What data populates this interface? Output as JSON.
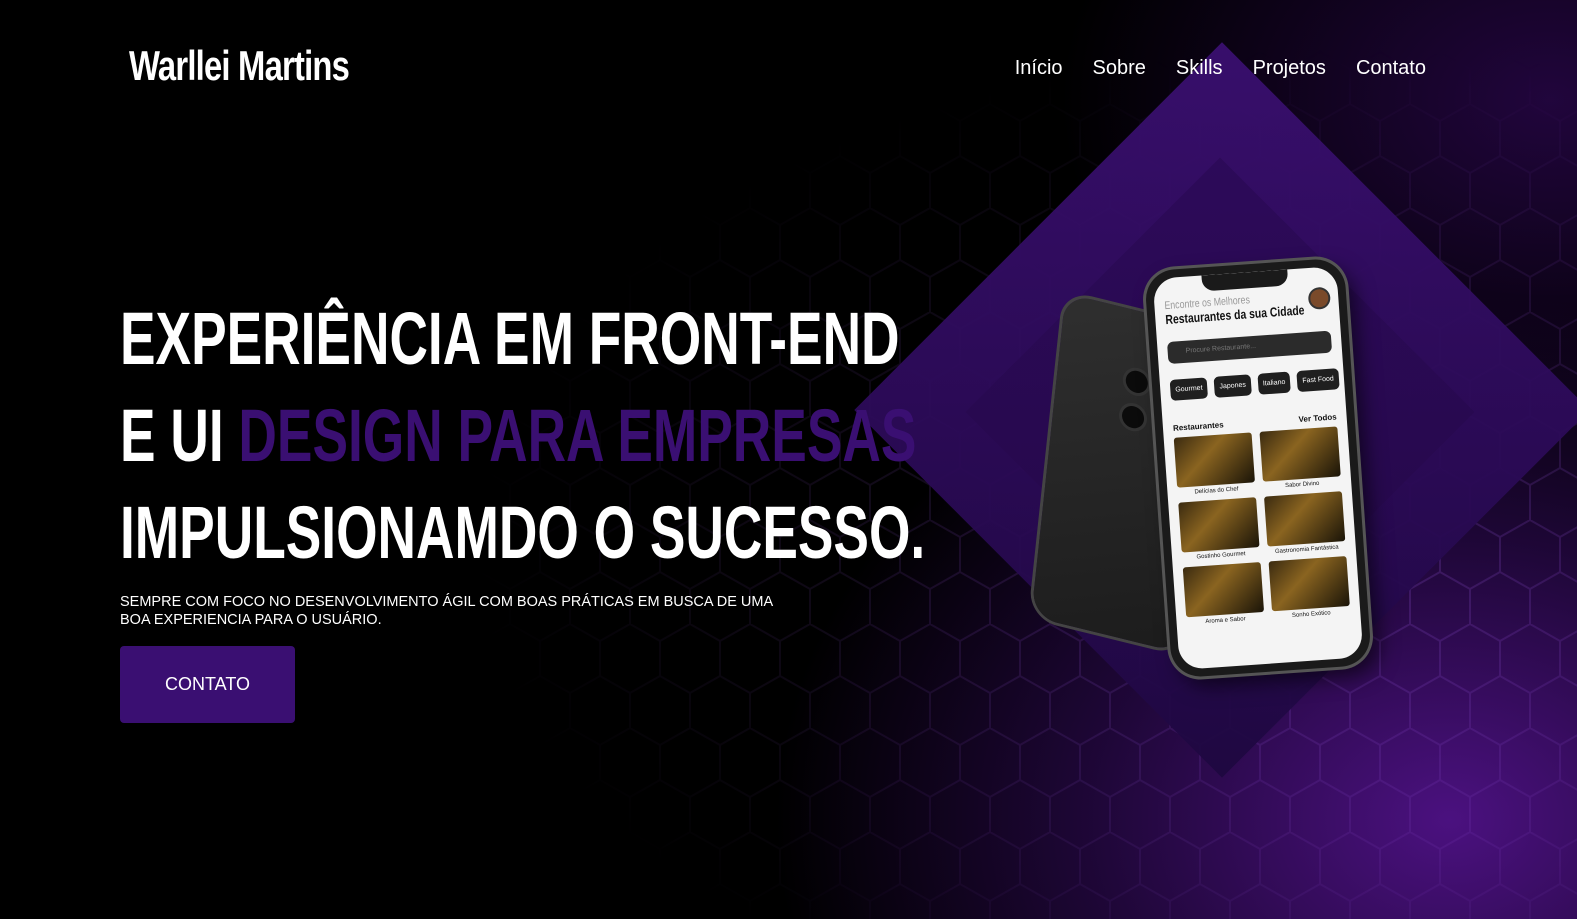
{
  "header": {
    "logo": "Warllei Martins",
    "nav": [
      "Início",
      "Sobre",
      "Skills",
      "Projetos",
      "Contato"
    ]
  },
  "hero": {
    "line1": "EXPERIÊNCIA EM FRONT-END",
    "line2_prefix": "E UI ",
    "line2_accent": "DESIGN PARA EMPRESAS",
    "line3": "IMPULSIONAMDO O SUCESSO.",
    "description": "SEMPRE COM FOCO NO DESENVOLVIMENTO ÁGIL COM BOAS PRÁTICAS EM BUSCA DE UMA BOA EXPERIENCIA PARA O USUÁRIO.",
    "cta_label": "CONTATO"
  },
  "phone": {
    "subtitle": "Encontre os Melhores",
    "title": "Restaurantes da sua Cidade",
    "search_placeholder": "Procure Restaurante...",
    "chips": [
      "Gourmet",
      "Japones",
      "Italiano",
      "Fast Food"
    ],
    "section_title": "Restaurantes",
    "section_link": "Ver Todos",
    "cards": [
      "Delícias do Chef",
      "Sabor Divino",
      "Gostinho Gourmet",
      "Gastronomia Fantástica",
      "Aroma e Sabor",
      "Sonho Exótico"
    ]
  },
  "colors": {
    "accent": "#3a0f72",
    "background": "#000000",
    "text": "#ffffff"
  }
}
